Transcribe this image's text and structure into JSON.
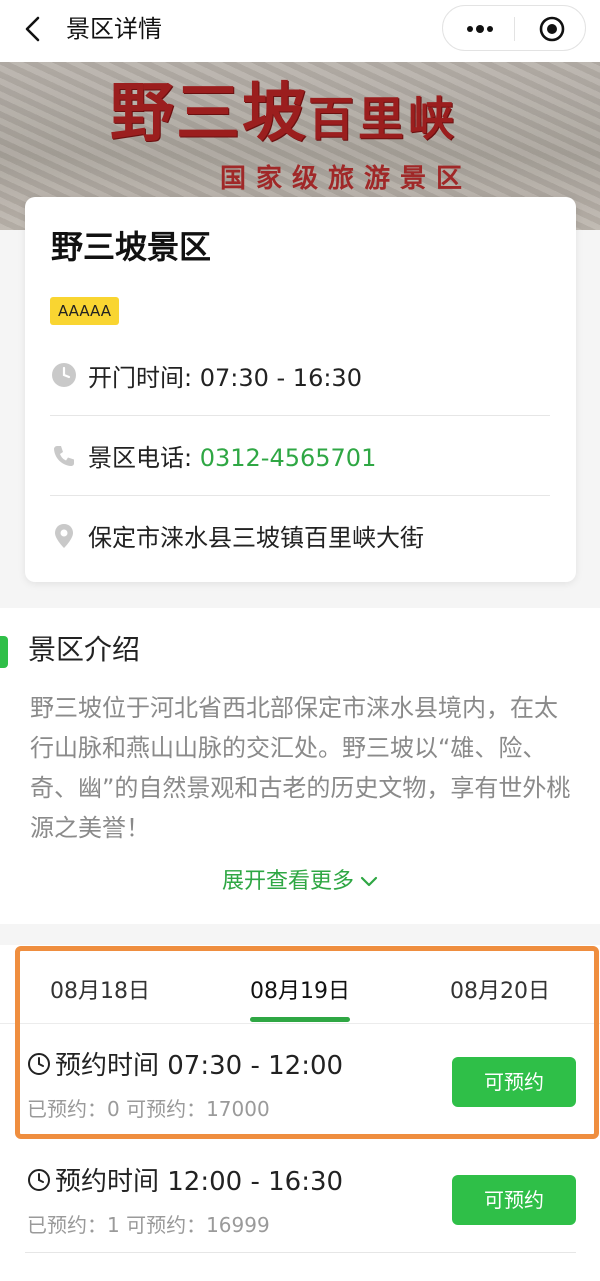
{
  "nav": {
    "title": "景区详情",
    "icons": [
      "back-icon",
      "more-icon",
      "close-icon"
    ]
  },
  "banner": {
    "sign_text_large": "野三坡",
    "sign_text_small": "百里峡",
    "sign_sub": "国家级旅游景区"
  },
  "scenic": {
    "name": "野三坡景区",
    "level": "AAAAA",
    "hours_label": "开门时间: ",
    "hours": "07:30 - 16:30",
    "phone_label": "景区电话: ",
    "phone": "0312-4565701",
    "address": "保定市涞水县三坡镇百里峡大街"
  },
  "intro": {
    "title": "景区介绍",
    "text": "野三坡位于河北省西北部保定市涞水县境内，在太行山脉和燕山山脉的交汇处。野三坡以“雄、险、奇、幽”的自然景观和古老的历史文物，享有世外桃源之美誉！",
    "expand": "展开查看更多"
  },
  "booking": {
    "dates": [
      "08月18日",
      "08月19日",
      "08月20日"
    ],
    "selected_date": "08月19日",
    "slots": [
      {
        "time": "预约时间 07:30 - 12:00",
        "counts": "已预约：0   可预约：17000",
        "button": "可预约"
      },
      {
        "time": "预约时间 12:00 - 16:30",
        "counts": "已预约：1   可预约：16999",
        "button": "可预约"
      }
    ]
  },
  "colors": {
    "accent_green": "#2fbf48",
    "phone_green": "#2fa744",
    "badge_yellow": "#f9d531",
    "highlight_orange": "#ef8e3f"
  }
}
